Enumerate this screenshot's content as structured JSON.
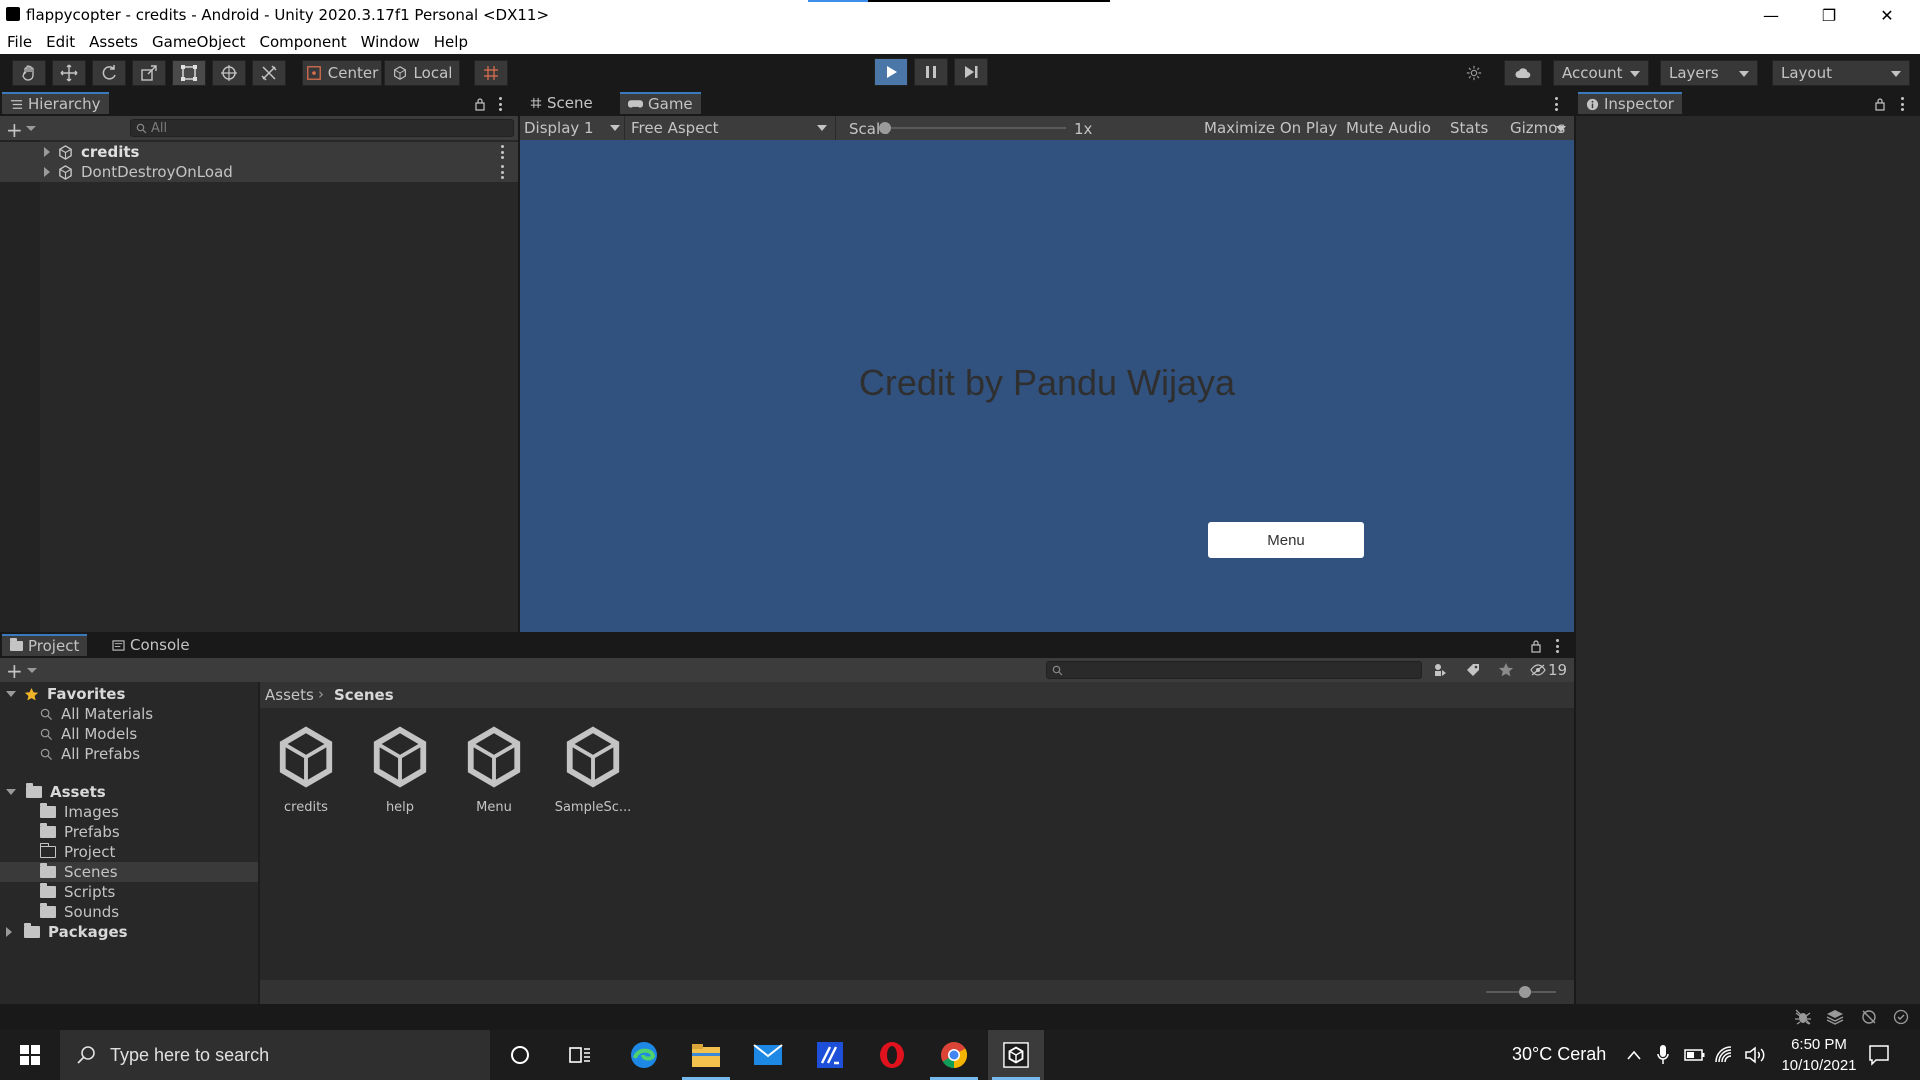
{
  "window": {
    "title": "flappycopter - credits - Android - Unity 2020.3.17f1 Personal <DX11>",
    "minimize": "—",
    "restore": "❐",
    "close": "✕"
  },
  "menu": [
    "File",
    "Edit",
    "Assets",
    "GameObject",
    "Component",
    "Window",
    "Help"
  ],
  "toolbar": {
    "pivot_label": "Center",
    "space_label": "Local",
    "account_label": "Account",
    "layers_label": "Layers",
    "layout_label": "Layout"
  },
  "hierarchy": {
    "tab_label": "Hierarchy",
    "search_placeholder": "All",
    "items": [
      {
        "label": "credits"
      },
      {
        "label": "DontDestroyOnLoad"
      }
    ]
  },
  "game_view": {
    "tabs": [
      "Scene",
      "Game"
    ],
    "display_label": "Display 1",
    "aspect_label": "Free Aspect",
    "scale_label": "Scale",
    "scale_value": "1x",
    "maximize_label": "Maximize On Play",
    "mute_label": "Mute Audio",
    "stats_label": "Stats",
    "gizmos_label": "Gizmos",
    "credit_text": "Credit by Pandu Wijaya",
    "menu_button_label": "Menu",
    "background_color": "#31517f"
  },
  "inspector": {
    "tab_label": "Inspector"
  },
  "project": {
    "tabs": [
      "Project",
      "Console"
    ],
    "hidden_count": "19",
    "breadcrumb": [
      "Assets",
      "Scenes"
    ],
    "favorites_label": "Favorites",
    "favorites": [
      "All Materials",
      "All Models",
      "All Prefabs"
    ],
    "assets_label": "Assets",
    "asset_folders": [
      "Images",
      "Prefabs",
      "Project",
      "Scenes",
      "Scripts",
      "Sounds"
    ],
    "packages_label": "Packages",
    "scene_files": [
      "credits",
      "help",
      "Menu",
      "SampleSc..."
    ]
  },
  "taskbar": {
    "search_placeholder": "Type here to search",
    "weather": "30°C  Cerah",
    "time": "6:50 PM",
    "date": "10/10/2021"
  },
  "colors": {
    "accent": "#3a79bb",
    "selection": "#2c5d87"
  }
}
